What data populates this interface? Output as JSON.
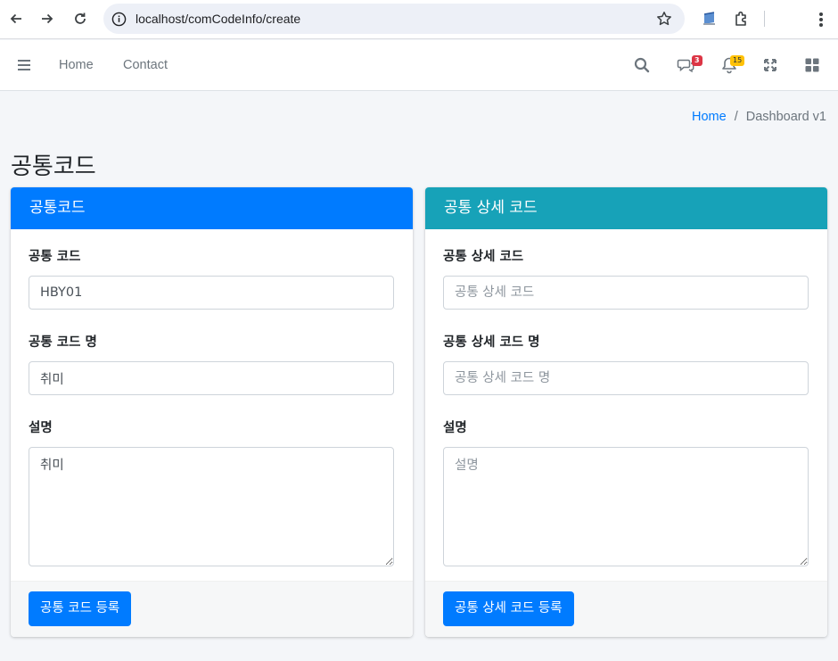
{
  "browser": {
    "url": "localhost/comCodeInfo/create"
  },
  "navbar": {
    "links": [
      "Home",
      "Contact"
    ],
    "messages_badge": "3",
    "notifications_badge": "15"
  },
  "breadcrumb": {
    "home": "Home",
    "separator": "/",
    "current": "Dashboard v1"
  },
  "page_title": "공통코드",
  "common_code_card": {
    "title": "공통코드",
    "code_label": "공통 코드",
    "code_value": "HBY01",
    "name_label": "공통 코드 명",
    "name_value": "취미",
    "desc_label": "설명",
    "desc_value": "취미",
    "submit_label": "공통 코드 등록"
  },
  "detail_code_card": {
    "title": "공통 상세 코드",
    "code_label": "공통 상세 코드",
    "code_placeholder": "공통 상세 코드",
    "name_label": "공통 상세 코드 명",
    "name_placeholder": "공통 상세 코드 명",
    "desc_label": "설명",
    "desc_placeholder": "설명",
    "submit_label": "공통 상세 코드 등록"
  },
  "colors": {
    "primary": "#007bff",
    "info": "#17a2b8",
    "danger": "#dc3545",
    "warning": "#ffc107"
  }
}
